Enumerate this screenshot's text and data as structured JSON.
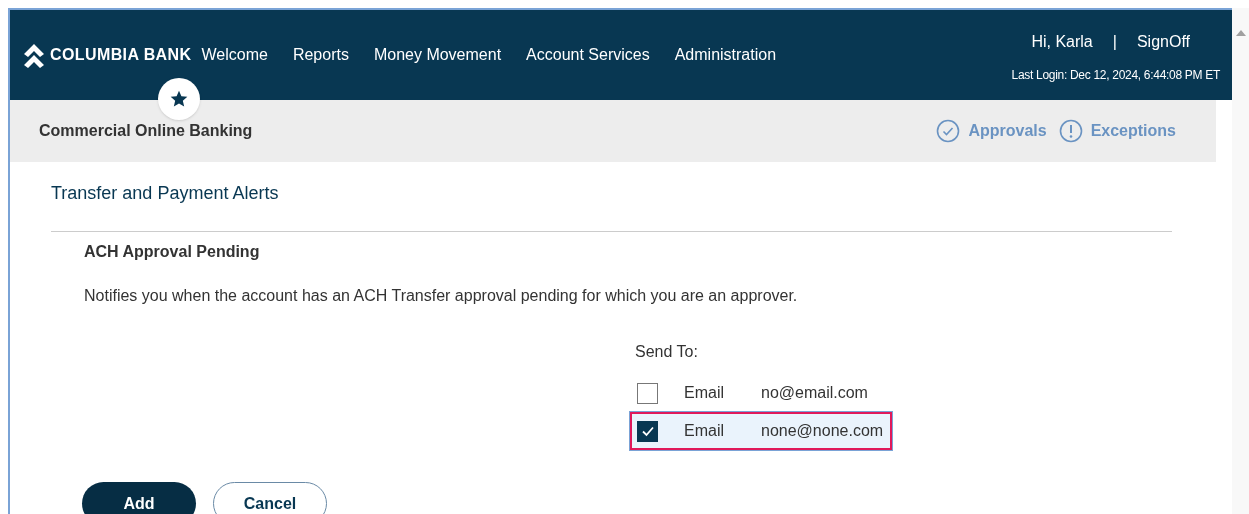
{
  "header": {
    "brand": "COLUMBIA BANK",
    "nav": [
      {
        "label": "Welcome"
      },
      {
        "label": "Reports"
      },
      {
        "label": "Money Movement"
      },
      {
        "label": "Account Services"
      },
      {
        "label": "Administration"
      }
    ],
    "greeting": "Hi, Karla",
    "separator": "|",
    "sign_off": "SignOff",
    "last_login": "Last Login: Dec 12, 2024, 6:44:08 PM ET"
  },
  "subheader": {
    "title": "Commercial Online Banking",
    "links": [
      {
        "kind": "check",
        "label": "Approvals"
      },
      {
        "kind": "alert",
        "label": "Exceptions"
      }
    ]
  },
  "section": {
    "title": "Transfer and Payment Alerts",
    "alert_name": "ACH Approval Pending",
    "description": "Notifies you when the account has an ACH Transfer approval pending for which you are an approver.",
    "send_to_label": "Send To:",
    "recipients": [
      {
        "type": "Email",
        "address": "no@email.com",
        "checked": false,
        "selected": false
      },
      {
        "type": "Email",
        "address": "none@none.com",
        "checked": true,
        "selected": true
      }
    ]
  },
  "buttons": [
    {
      "kind": "primary",
      "label": "Add"
    },
    {
      "kind": "secondary",
      "label": "Cancel"
    }
  ]
}
